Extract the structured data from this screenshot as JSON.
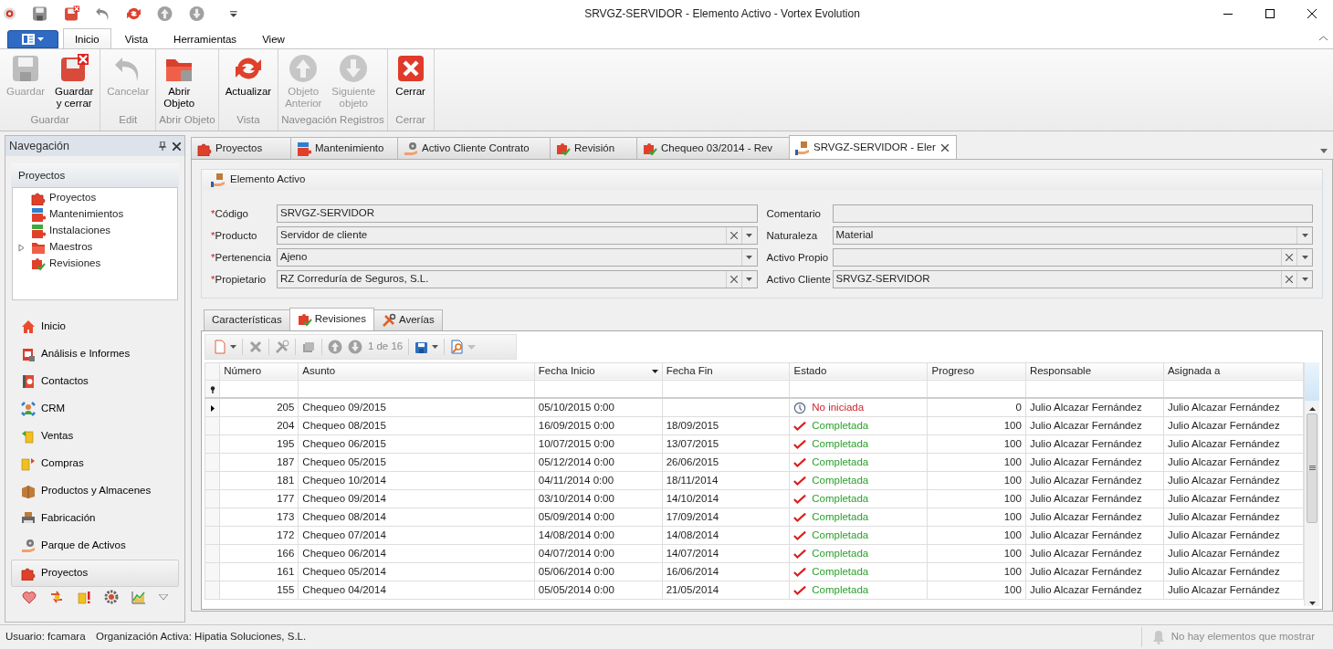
{
  "window": {
    "title": "SRVGZ-SERVIDOR - Elemento Activo - Vortex Evolution"
  },
  "ribbon": {
    "tabs": [
      {
        "label": "Inicio",
        "selected": true
      },
      {
        "label": "Vista",
        "selected": false
      },
      {
        "label": "Herramientas",
        "selected": false
      },
      {
        "label": "View",
        "selected": false
      }
    ],
    "groups": [
      {
        "label": "Guardar",
        "buttons": [
          {
            "label": "Guardar",
            "disabled": true
          },
          {
            "label": "Guardar\ny cerrar",
            "disabled": false
          }
        ]
      },
      {
        "label": "Edit",
        "buttons": [
          {
            "label": "Cancelar",
            "disabled": true
          }
        ]
      },
      {
        "label": "Abrir Objeto",
        "buttons": [
          {
            "label": "Abrir\nObjeto",
            "disabled": false
          }
        ]
      },
      {
        "label": "Vista",
        "buttons": [
          {
            "label": "Actualizar",
            "disabled": false
          }
        ]
      },
      {
        "label": "Navegación Registros",
        "buttons": [
          {
            "label": "Objeto\nAnterior",
            "disabled": true
          },
          {
            "label": "Siguiente\nobjeto",
            "disabled": true
          }
        ]
      },
      {
        "label": "Cerrar",
        "buttons": [
          {
            "label": "Cerrar",
            "disabled": false
          }
        ]
      }
    ]
  },
  "navigation": {
    "title": "Navegación",
    "section": "Proyectos",
    "tree": [
      {
        "label": "Proyectos"
      },
      {
        "label": "Mantenimientos"
      },
      {
        "label": "Instalaciones"
      },
      {
        "label": "Maestros",
        "expanded": false
      },
      {
        "label": "Revisiones"
      }
    ],
    "modules": [
      {
        "label": "Inicio",
        "selected": false
      },
      {
        "label": "Análisis e Informes",
        "selected": false
      },
      {
        "label": "Contactos",
        "selected": false
      },
      {
        "label": "CRM",
        "selected": false
      },
      {
        "label": "Ventas",
        "selected": false
      },
      {
        "label": "Compras",
        "selected": false
      },
      {
        "label": "Productos y Almacenes",
        "selected": false
      },
      {
        "label": "Fabricación",
        "selected": false
      },
      {
        "label": "Parque de Activos",
        "selected": false
      },
      {
        "label": "Proyectos",
        "selected": true
      }
    ]
  },
  "document_tabs": [
    {
      "label": "Proyectos",
      "selected": false
    },
    {
      "label": "Mantenimiento",
      "selected": false
    },
    {
      "label": "Activo Cliente Contrato",
      "selected": false
    },
    {
      "label": "Revisión",
      "selected": false
    },
    {
      "label": "Chequeo 03/2014 - Rev",
      "selected": false
    },
    {
      "label": "SRVGZ-SERVIDOR - Eler",
      "selected": true
    }
  ],
  "form": {
    "title": "Elemento Activo",
    "left_fields": [
      {
        "required_mark": "*",
        "label": "Código",
        "value": "SRVGZ-SERVIDOR",
        "kind": "text"
      },
      {
        "required_mark": "*",
        "label": "Producto",
        "value": "Servidor de cliente",
        "kind": "combo_clear"
      },
      {
        "required_mark": "*",
        "label": "Pertenencia",
        "value": "Ajeno",
        "kind": "combo"
      },
      {
        "required_mark": "*",
        "label": "Propietario",
        "value": "RZ Correduría de Seguros, S.L.",
        "kind": "combo_clear"
      }
    ],
    "right_fields": [
      {
        "label": "Comentario",
        "kind": "text"
      },
      {
        "label": "Naturaleza",
        "value": "Material",
        "kind": "combo"
      },
      {
        "label": "Activo Propio",
        "kind": "combo_clear"
      },
      {
        "label": "Activo Cliente",
        "value": "SRVGZ-SERVIDOR",
        "kind": "combo_clear"
      }
    ]
  },
  "sub_tabs": [
    {
      "label": "Características",
      "selected": false
    },
    {
      "label": "Revisiones",
      "selected": true
    },
    {
      "label": "Averías",
      "selected": false
    }
  ],
  "grid_toolbar": {
    "record_counter": "1 de 16"
  },
  "table": {
    "columns": [
      {
        "label": "Número",
        "sorted": false
      },
      {
        "label": "Asunto",
        "sorted": false
      },
      {
        "label": "Fecha Inicio",
        "sorted": true
      },
      {
        "label": "Fecha Fin",
        "sorted": false
      },
      {
        "label": "Estado",
        "sorted": false
      },
      {
        "label": "Progreso",
        "sorted": false
      },
      {
        "label": "Responsable",
        "sorted": false
      },
      {
        "label": "Asignada a",
        "sorted": false
      }
    ],
    "rows": [
      {
        "current": true,
        "numero": "205",
        "asunto": "Chequeo 09/2015",
        "fecha_inicio": "05/10/2015 0:00",
        "status": {
          "label": "No iniciada",
          "kind": "not_started"
        },
        "progreso": "0",
        "responsable": "Julio Alcazar Fernández",
        "asignada_a": "Julio Alcazar Fernández"
      },
      {
        "current": false,
        "numero": "204",
        "asunto": "Chequeo 08/2015",
        "fecha_inicio": "16/09/2015 0:00",
        "fecha_fin": "18/09/2015",
        "status": {
          "label": "Completada",
          "kind": "completed"
        },
        "progreso": "100",
        "responsable": "Julio Alcazar Fernández",
        "asignada_a": "Julio Alcazar Fernández"
      },
      {
        "current": false,
        "numero": "195",
        "asunto": "Chequeo 06/2015",
        "fecha_inicio": "10/07/2015 0:00",
        "fecha_fin": "13/07/2015",
        "status": {
          "label": "Completada",
          "kind": "completed"
        },
        "progreso": "100",
        "responsable": "Julio Alcazar Fernández",
        "asignada_a": "Julio Alcazar Fernández"
      },
      {
        "current": false,
        "numero": "187",
        "asunto": "Chequeo 05/2015",
        "fecha_inicio": "05/12/2014 0:00",
        "fecha_fin": "26/06/2015",
        "status": {
          "label": "Completada",
          "kind": "completed"
        },
        "progreso": "100",
        "responsable": "Julio Alcazar Fernández",
        "asignada_a": "Julio Alcazar Fernández"
      },
      {
        "current": false,
        "numero": "181",
        "asunto": "Chequeo 10/2014",
        "fecha_inicio": "04/11/2014 0:00",
        "fecha_fin": "18/11/2014",
        "status": {
          "label": "Completada",
          "kind": "completed"
        },
        "progreso": "100",
        "responsable": "Julio Alcazar Fernández",
        "asignada_a": "Julio Alcazar Fernández"
      },
      {
        "current": false,
        "numero": "177",
        "asunto": "Chequeo 09/2014",
        "fecha_inicio": "03/10/2014 0:00",
        "fecha_fin": "14/10/2014",
        "status": {
          "label": "Completada",
          "kind": "completed"
        },
        "progreso": "100",
        "responsable": "Julio Alcazar Fernández",
        "asignada_a": "Julio Alcazar Fernández"
      },
      {
        "current": false,
        "numero": "173",
        "asunto": "Chequeo 08/2014",
        "fecha_inicio": "05/09/2014 0:00",
        "fecha_fin": "17/09/2014",
        "status": {
          "label": "Completada",
          "kind": "completed"
        },
        "progreso": "100",
        "responsable": "Julio Alcazar Fernández",
        "asignada_a": "Julio Alcazar Fernández"
      },
      {
        "current": false,
        "numero": "172",
        "asunto": "Chequeo 07/2014",
        "fecha_inicio": "14/08/2014 0:00",
        "fecha_fin": "14/08/2014",
        "status": {
          "label": "Completada",
          "kind": "completed"
        },
        "progreso": "100",
        "responsable": "Julio Alcazar Fernández",
        "asignada_a": "Julio Alcazar Fernández"
      },
      {
        "current": false,
        "numero": "166",
        "asunto": "Chequeo 06/2014",
        "fecha_inicio": "04/07/2014 0:00",
        "fecha_fin": "14/07/2014",
        "status": {
          "label": "Completada",
          "kind": "completed"
        },
        "progreso": "100",
        "responsable": "Julio Alcazar Fernández",
        "asignada_a": "Julio Alcazar Fernández"
      },
      {
        "current": false,
        "numero": "161",
        "asunto": "Chequeo 05/2014",
        "fecha_inicio": "05/06/2014 0:00",
        "fecha_fin": "16/06/2014",
        "status": {
          "label": "Completada",
          "kind": "completed"
        },
        "progreso": "100",
        "responsable": "Julio Alcazar Fernández",
        "asignada_a": "Julio Alcazar Fernández"
      },
      {
        "current": false,
        "numero": "155",
        "asunto": "Chequeo 04/2014",
        "fecha_inicio": "05/05/2014 0:00",
        "fecha_fin": "21/05/2014",
        "status": {
          "label": "Completada",
          "kind": "completed"
        },
        "progreso": "100",
        "responsable": "Julio Alcazar Fernández",
        "asignada_a": "Julio Alcazar Fernández"
      }
    ]
  },
  "status_bar": {
    "user": "Usuario: fcamara",
    "organization": "Organización Activa: Hipatia Soluciones, S.L.",
    "notifications": "No hay elementos que mostrar"
  }
}
